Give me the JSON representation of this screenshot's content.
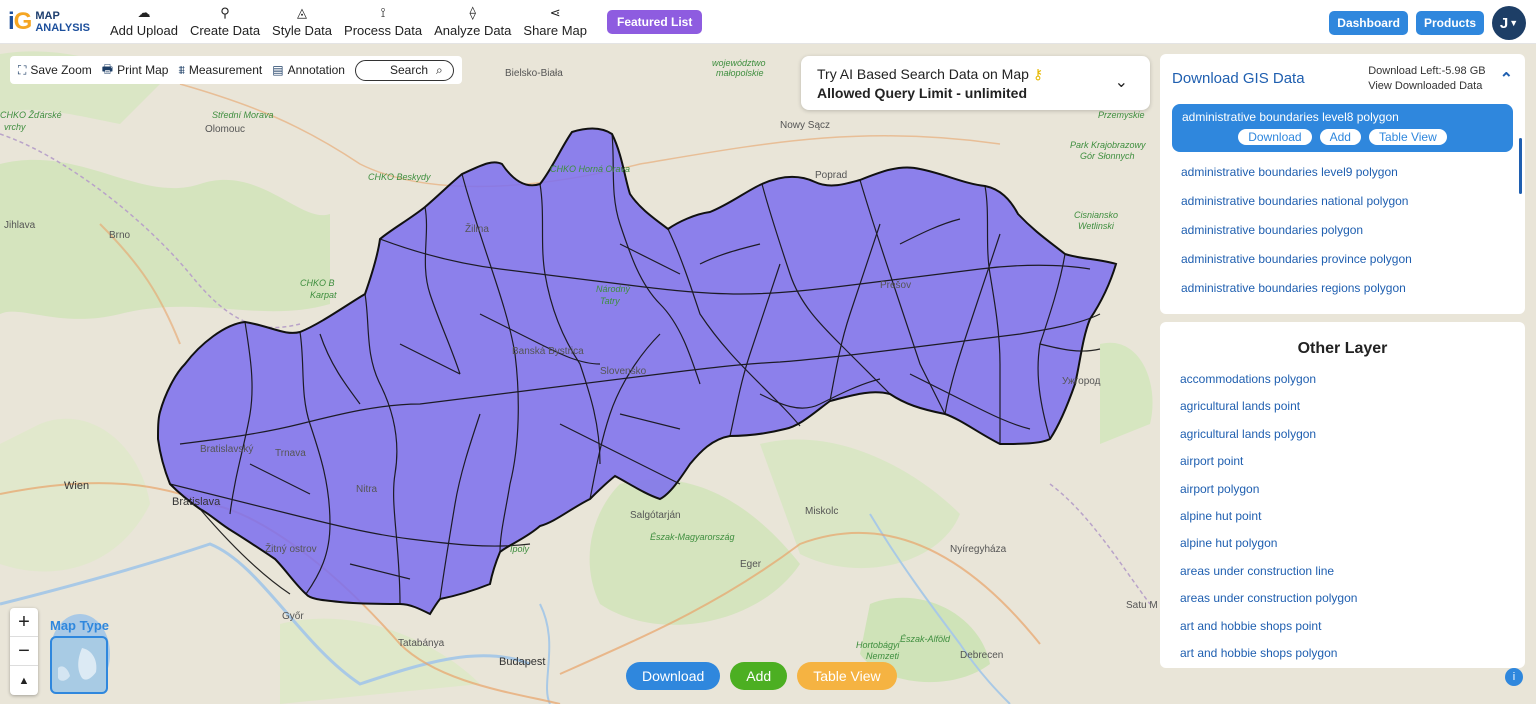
{
  "logo": {
    "line1": "MAP",
    "line2": "ANALYSIS"
  },
  "nav": [
    {
      "label": "Add Upload",
      "icon": "cloud-upload-icon",
      "glyph": "☁"
    },
    {
      "label": "Create Data",
      "icon": "map-pin-icon",
      "glyph": "⚲"
    },
    {
      "label": "Style Data",
      "icon": "paint-bucket-icon",
      "glyph": "◬"
    },
    {
      "label": "Process Data",
      "icon": "process-icon",
      "glyph": "⟟"
    },
    {
      "label": "Analyze Data",
      "icon": "analyze-icon",
      "glyph": "⟠"
    },
    {
      "label": "Share Map",
      "icon": "share-icon",
      "glyph": "⋖"
    }
  ],
  "featured_label": "Featured List",
  "top_right": {
    "dashboard": "Dashboard",
    "products": "Products",
    "avatar": "J"
  },
  "map_tools": {
    "save_zoom": "Save Zoom",
    "print_map": "Print Map",
    "measurement": "Measurement",
    "annotation": "Annotation",
    "search": "Search"
  },
  "ai_box": {
    "line1": "Try AI Based Search Data on Map",
    "line2": "Allowed Query Limit - unlimited"
  },
  "gis_panel": {
    "title": "Download GIS Data",
    "download_left": "Download Left:-5.98 GB",
    "view_downloaded": "View Downloaded Data",
    "selected": {
      "name": "administrative boundaries level8 polygon",
      "download": "Download",
      "add": "Add",
      "table_view": "Table View"
    },
    "items": [
      "administrative boundaries level9 polygon",
      "administrative boundaries national polygon",
      "administrative boundaries polygon",
      "administrative boundaries province polygon",
      "administrative boundaries regions polygon"
    ]
  },
  "other_layer": {
    "title": "Other Layer",
    "items": [
      "accommodations polygon",
      "agricultural lands point",
      "agricultural lands polygon",
      "airport point",
      "airport polygon",
      "alpine hut point",
      "alpine hut polygon",
      "areas under construction line",
      "areas under construction polygon",
      "art and hobbie shops point",
      "art and hobbie shops polygon"
    ]
  },
  "map_type_label": "Map Type",
  "bottom": {
    "download": "Download",
    "add": "Add",
    "table_view": "Table View"
  },
  "map_labels": {
    "wien": "Wien",
    "budapest": "Budapest",
    "brno": "Brno",
    "zilina": "Žilina",
    "presov": "Prešov",
    "miskolc": "Miskolc",
    "debrecen": "Debrecen",
    "nitra": "Nitra",
    "gyor": "Győr",
    "eger": "Eger",
    "salgotarjan": "Salgótarján",
    "nyiregyhaza": "Nyíregyháza",
    "olomouc": "Olomouc",
    "nowy_sacz": "Nowy Sącz",
    "tatabanya": "Tatabánya",
    "jihlava": "Jihlava",
    "banska": "Banská Bystrica",
    "zitny": "Žitný ostrov",
    "velko_biala": "Bielsko-Biała",
    "wojewodztwo": "województwo",
    "malopolskie": "małopolskie",
    "przemysl": "Przemyskie",
    "chko_beskydy": "CHKO Beskydy",
    "chko_b": "CHKO B",
    "karpat": "Karpat",
    "strední_morava": "Střední Morava",
    "zdarske": "CHKO Žďárské",
    "vrchy": "vrchy",
    "narodny": "Národný",
    "tatry": "Tatry",
    "park_krajobrazowy": "Park Krajobrazowy",
    "gor_slonnych": "Gór Słonnych",
    "cisniansko": "Cisniansko",
    "wetlinski": "Wetlinski",
    "uzhorod": "Ужгород",
    "ipoly": "Ipoly",
    "eszak_magyar": "Észak-Magyarország",
    "hortobagy": "Hortobágyi",
    "nemzeti": "Nemzeti",
    "eszak_alfold": "Észak-Alföld",
    "satu_mare": "Satu M",
    "slovensko": "Slovensko",
    "bratislavsky": "Bratislavský",
    "trnava": "Trnava",
    "orava": "CHKO Horná Orava",
    "poprad": "Poprad",
    "bratislava": "Bratislava"
  }
}
